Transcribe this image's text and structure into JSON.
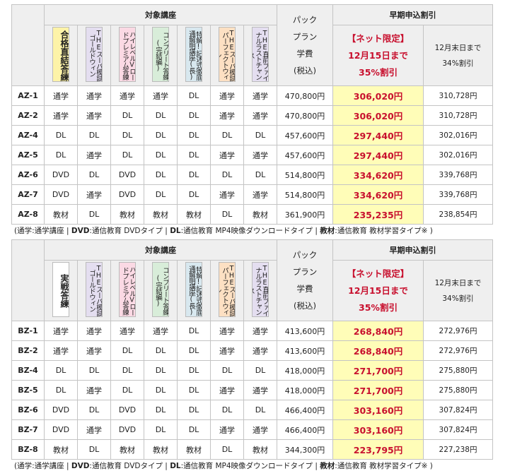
{
  "header": {
    "target_courses": "対象講座",
    "pack": "パック",
    "plan": "プラン",
    "fee": "学費",
    "tax": "(税込)",
    "early": "早期申込割引",
    "net_limited": "【ネット限定】",
    "net_deadline": "12月15日まで",
    "net_discount": "35%割引",
    "dec_deadline": "12月末日まで",
    "dec_discount": "34%割引"
  },
  "tableA": {
    "courses": [
      {
        "name": "合格直結答練"
      },
      {
        "name": "THEスーパ模試ゴールドウィン"
      },
      {
        "name": "ハイレベルVロードプレミアム答練"
      },
      {
        "name": "コンプリート答練(完結編)"
      },
      {
        "name": "特解!記述式徹底通解明講座(長)"
      },
      {
        "name": "THEスーパ模試パーフェクトウィン"
      },
      {
        "name": "THE直前ファイナルラストチャンス"
      }
    ],
    "rows": [
      {
        "code": "AZ-1",
        "c": [
          "通学",
          "通学",
          "通学",
          "通学",
          "DL",
          "通学",
          "通学"
        ],
        "price": "470,800円",
        "net": "306,020円",
        "dec": "310,728円"
      },
      {
        "code": "AZ-2",
        "c": [
          "通学",
          "通学",
          "DL",
          "DL",
          "DL",
          "通学",
          "通学"
        ],
        "price": "470,800円",
        "net": "306,020円",
        "dec": "310,728円"
      },
      {
        "code": "AZ-4",
        "c": [
          "DL",
          "DL",
          "DL",
          "DL",
          "DL",
          "DL",
          "DL"
        ],
        "price": "457,600円",
        "net": "297,440円",
        "dec": "302,016円"
      },
      {
        "code": "AZ-5",
        "c": [
          "DL",
          "通学",
          "DL",
          "DL",
          "DL",
          "通学",
          "通学"
        ],
        "price": "457,600円",
        "net": "297,440円",
        "dec": "302,016円"
      },
      {
        "code": "AZ-6",
        "c": [
          "DVD",
          "DL",
          "DVD",
          "DL",
          "DL",
          "DL",
          "DL"
        ],
        "price": "514,800円",
        "net": "334,620円",
        "dec": "339,768円"
      },
      {
        "code": "AZ-7",
        "c": [
          "DVD",
          "通学",
          "DVD",
          "DL",
          "DL",
          "通学",
          "通学"
        ],
        "price": "514,800円",
        "net": "334,620円",
        "dec": "339,768円"
      },
      {
        "code": "AZ-8",
        "c": [
          "教材",
          "DL",
          "教材",
          "教材",
          "教材",
          "DL",
          "教材"
        ],
        "price": "361,900円",
        "net": "235,235円",
        "dec": "238,854円"
      }
    ]
  },
  "tableB": {
    "courses": [
      {
        "name": "実戦答練"
      },
      {
        "name": "THEスーパ模試ゴールドウィン"
      },
      {
        "name": "ハイレベルVロードプレミアム答練"
      },
      {
        "name": "コンプリート答練(完結編)"
      },
      {
        "name": "特解!記述式徹底通解明講座(長)"
      },
      {
        "name": "THEスーパ模試パーフェクトウィン"
      },
      {
        "name": "THE直前ファイナルラストチャンス"
      }
    ],
    "rows": [
      {
        "code": "BZ-1",
        "c": [
          "通学",
          "通学",
          "通学",
          "通学",
          "DL",
          "通学",
          "通学"
        ],
        "price": "413,600円",
        "net": "268,840円",
        "dec": "272,976円"
      },
      {
        "code": "BZ-2",
        "c": [
          "通学",
          "通学",
          "DL",
          "DL",
          "DL",
          "通学",
          "通学"
        ],
        "price": "413,600円",
        "net": "268,840円",
        "dec": "272,976円"
      },
      {
        "code": "BZ-4",
        "c": [
          "DL",
          "DL",
          "DL",
          "DL",
          "DL",
          "DL",
          "DL"
        ],
        "price": "418,000円",
        "net": "271,700円",
        "dec": "275,880円"
      },
      {
        "code": "BZ-5",
        "c": [
          "DL",
          "通学",
          "DL",
          "DL",
          "DL",
          "通学",
          "通学"
        ],
        "price": "418,000円",
        "net": "271,700円",
        "dec": "275,880円"
      },
      {
        "code": "BZ-6",
        "c": [
          "DVD",
          "DL",
          "DVD",
          "DL",
          "DL",
          "DL",
          "DL"
        ],
        "price": "466,400円",
        "net": "303,160円",
        "dec": "307,824円"
      },
      {
        "code": "BZ-7",
        "c": [
          "DVD",
          "通学",
          "DVD",
          "DL",
          "DL",
          "通学",
          "通学"
        ],
        "price": "466,400円",
        "net": "303,160円",
        "dec": "307,824円"
      },
      {
        "code": "BZ-8",
        "c": [
          "教材",
          "DL",
          "教材",
          "教材",
          "教材",
          "DL",
          "教材"
        ],
        "price": "344,300円",
        "net": "223,795円",
        "dec": "227,238円"
      }
    ]
  },
  "legend": {
    "t1": "(通学:通学講座 |",
    "k2": "DVD",
    "t2": ":通信教育 DVDタイプ |",
    "k3": "DL",
    "t3": ":通信教育 MP4映像ダウンロードタイプ |",
    "k4": "教材",
    "t4": ":通信教育 教材学習タイプ※ )"
  },
  "colors": {
    "highlight_bg": "#fffdb8",
    "highlight_text": "#c8102e",
    "header_bg": "#efefef",
    "border": "#c4c4c4"
  }
}
